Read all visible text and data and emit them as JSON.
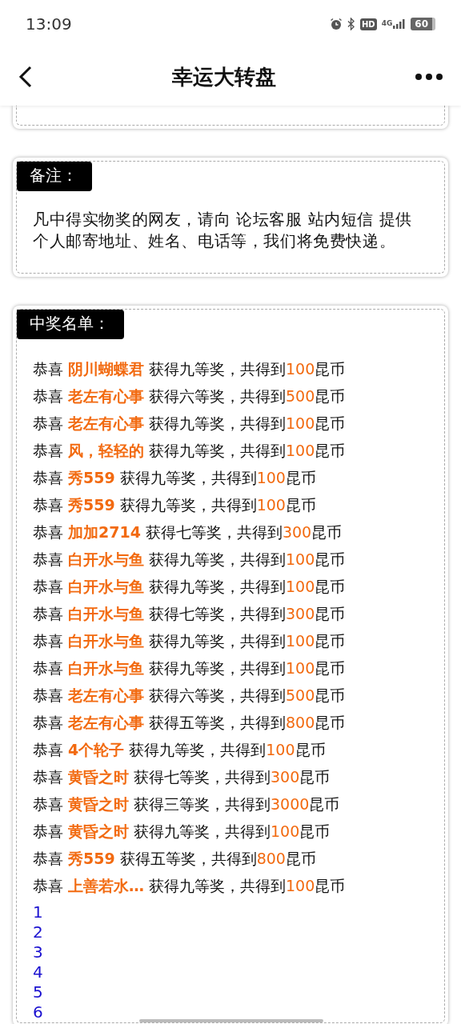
{
  "status_bar": {
    "time": "13:09",
    "hd": "HD",
    "network": "4G",
    "battery": "60"
  },
  "header": {
    "title": "幸运大转盘"
  },
  "notes": {
    "title": "备注：",
    "text": "凡中得实物奖的网友，请向 论坛客服 站内短信 提供个人邮寄地址、姓名、电话等，我们将免费快递。"
  },
  "winners": {
    "title": "中奖名单：",
    "rows": [
      {
        "lead": "恭喜",
        "name": "阴川蝴蝶君",
        "middle": "获得九等奖，共得到",
        "amount": "100",
        "unit": "昆币"
      },
      {
        "lead": "恭喜",
        "name": "老左有心事",
        "middle": "获得六等奖，共得到",
        "amount": "500",
        "unit": "昆币"
      },
      {
        "lead": "恭喜",
        "name": "老左有心事",
        "middle": "获得九等奖，共得到",
        "amount": "100",
        "unit": "昆币"
      },
      {
        "lead": "恭喜",
        "name": "风，轻轻的",
        "middle": "获得九等奖，共得到",
        "amount": "100",
        "unit": "昆币"
      },
      {
        "lead": "恭喜",
        "name": "秀559",
        "middle": "获得九等奖，共得到",
        "amount": "100",
        "unit": "昆币"
      },
      {
        "lead": "恭喜",
        "name": "秀559",
        "middle": "获得九等奖，共得到",
        "amount": "100",
        "unit": "昆币"
      },
      {
        "lead": "恭喜",
        "name": "加加2714",
        "middle": "获得七等奖，共得到",
        "amount": "300",
        "unit": "昆币"
      },
      {
        "lead": "恭喜",
        "name": "白开水与鱼",
        "middle": "获得九等奖，共得到",
        "amount": "100",
        "unit": "昆币"
      },
      {
        "lead": "恭喜",
        "name": "白开水与鱼",
        "middle": "获得九等奖，共得到",
        "amount": "100",
        "unit": "昆币"
      },
      {
        "lead": "恭喜",
        "name": "白开水与鱼",
        "middle": "获得七等奖，共得到",
        "amount": "300",
        "unit": "昆币"
      },
      {
        "lead": "恭喜",
        "name": "白开水与鱼",
        "middle": "获得九等奖，共得到",
        "amount": "100",
        "unit": "昆币"
      },
      {
        "lead": "恭喜",
        "name": "白开水与鱼",
        "middle": "获得九等奖，共得到",
        "amount": "100",
        "unit": "昆币"
      },
      {
        "lead": "恭喜",
        "name": "老左有心事",
        "middle": "获得六等奖，共得到",
        "amount": "500",
        "unit": "昆币"
      },
      {
        "lead": "恭喜",
        "name": "老左有心事",
        "middle": "获得五等奖，共得到",
        "amount": "800",
        "unit": "昆币"
      },
      {
        "lead": "恭喜",
        "name": "4个轮子",
        "middle": "获得九等奖，共得到",
        "amount": "100",
        "unit": "昆币"
      },
      {
        "lead": "恭喜",
        "name": "黄昏之时",
        "middle": "获得七等奖，共得到",
        "amount": "300",
        "unit": "昆币"
      },
      {
        "lead": "恭喜",
        "name": "黄昏之时",
        "middle": "获得三等奖，共得到",
        "amount": "3000",
        "unit": "昆币"
      },
      {
        "lead": "恭喜",
        "name": "黄昏之时",
        "middle": "获得九等奖，共得到",
        "amount": "100",
        "unit": "昆币"
      },
      {
        "lead": "恭喜",
        "name": "秀559",
        "middle": "获得五等奖，共得到",
        "amount": "800",
        "unit": "昆币"
      },
      {
        "lead": "恭喜",
        "name": "上善若水…",
        "middle": "获得九等奖，共得到",
        "amount": "100",
        "unit": "昆币"
      }
    ],
    "pages": [
      "1",
      "2",
      "3",
      "4",
      "5",
      "6"
    ]
  }
}
